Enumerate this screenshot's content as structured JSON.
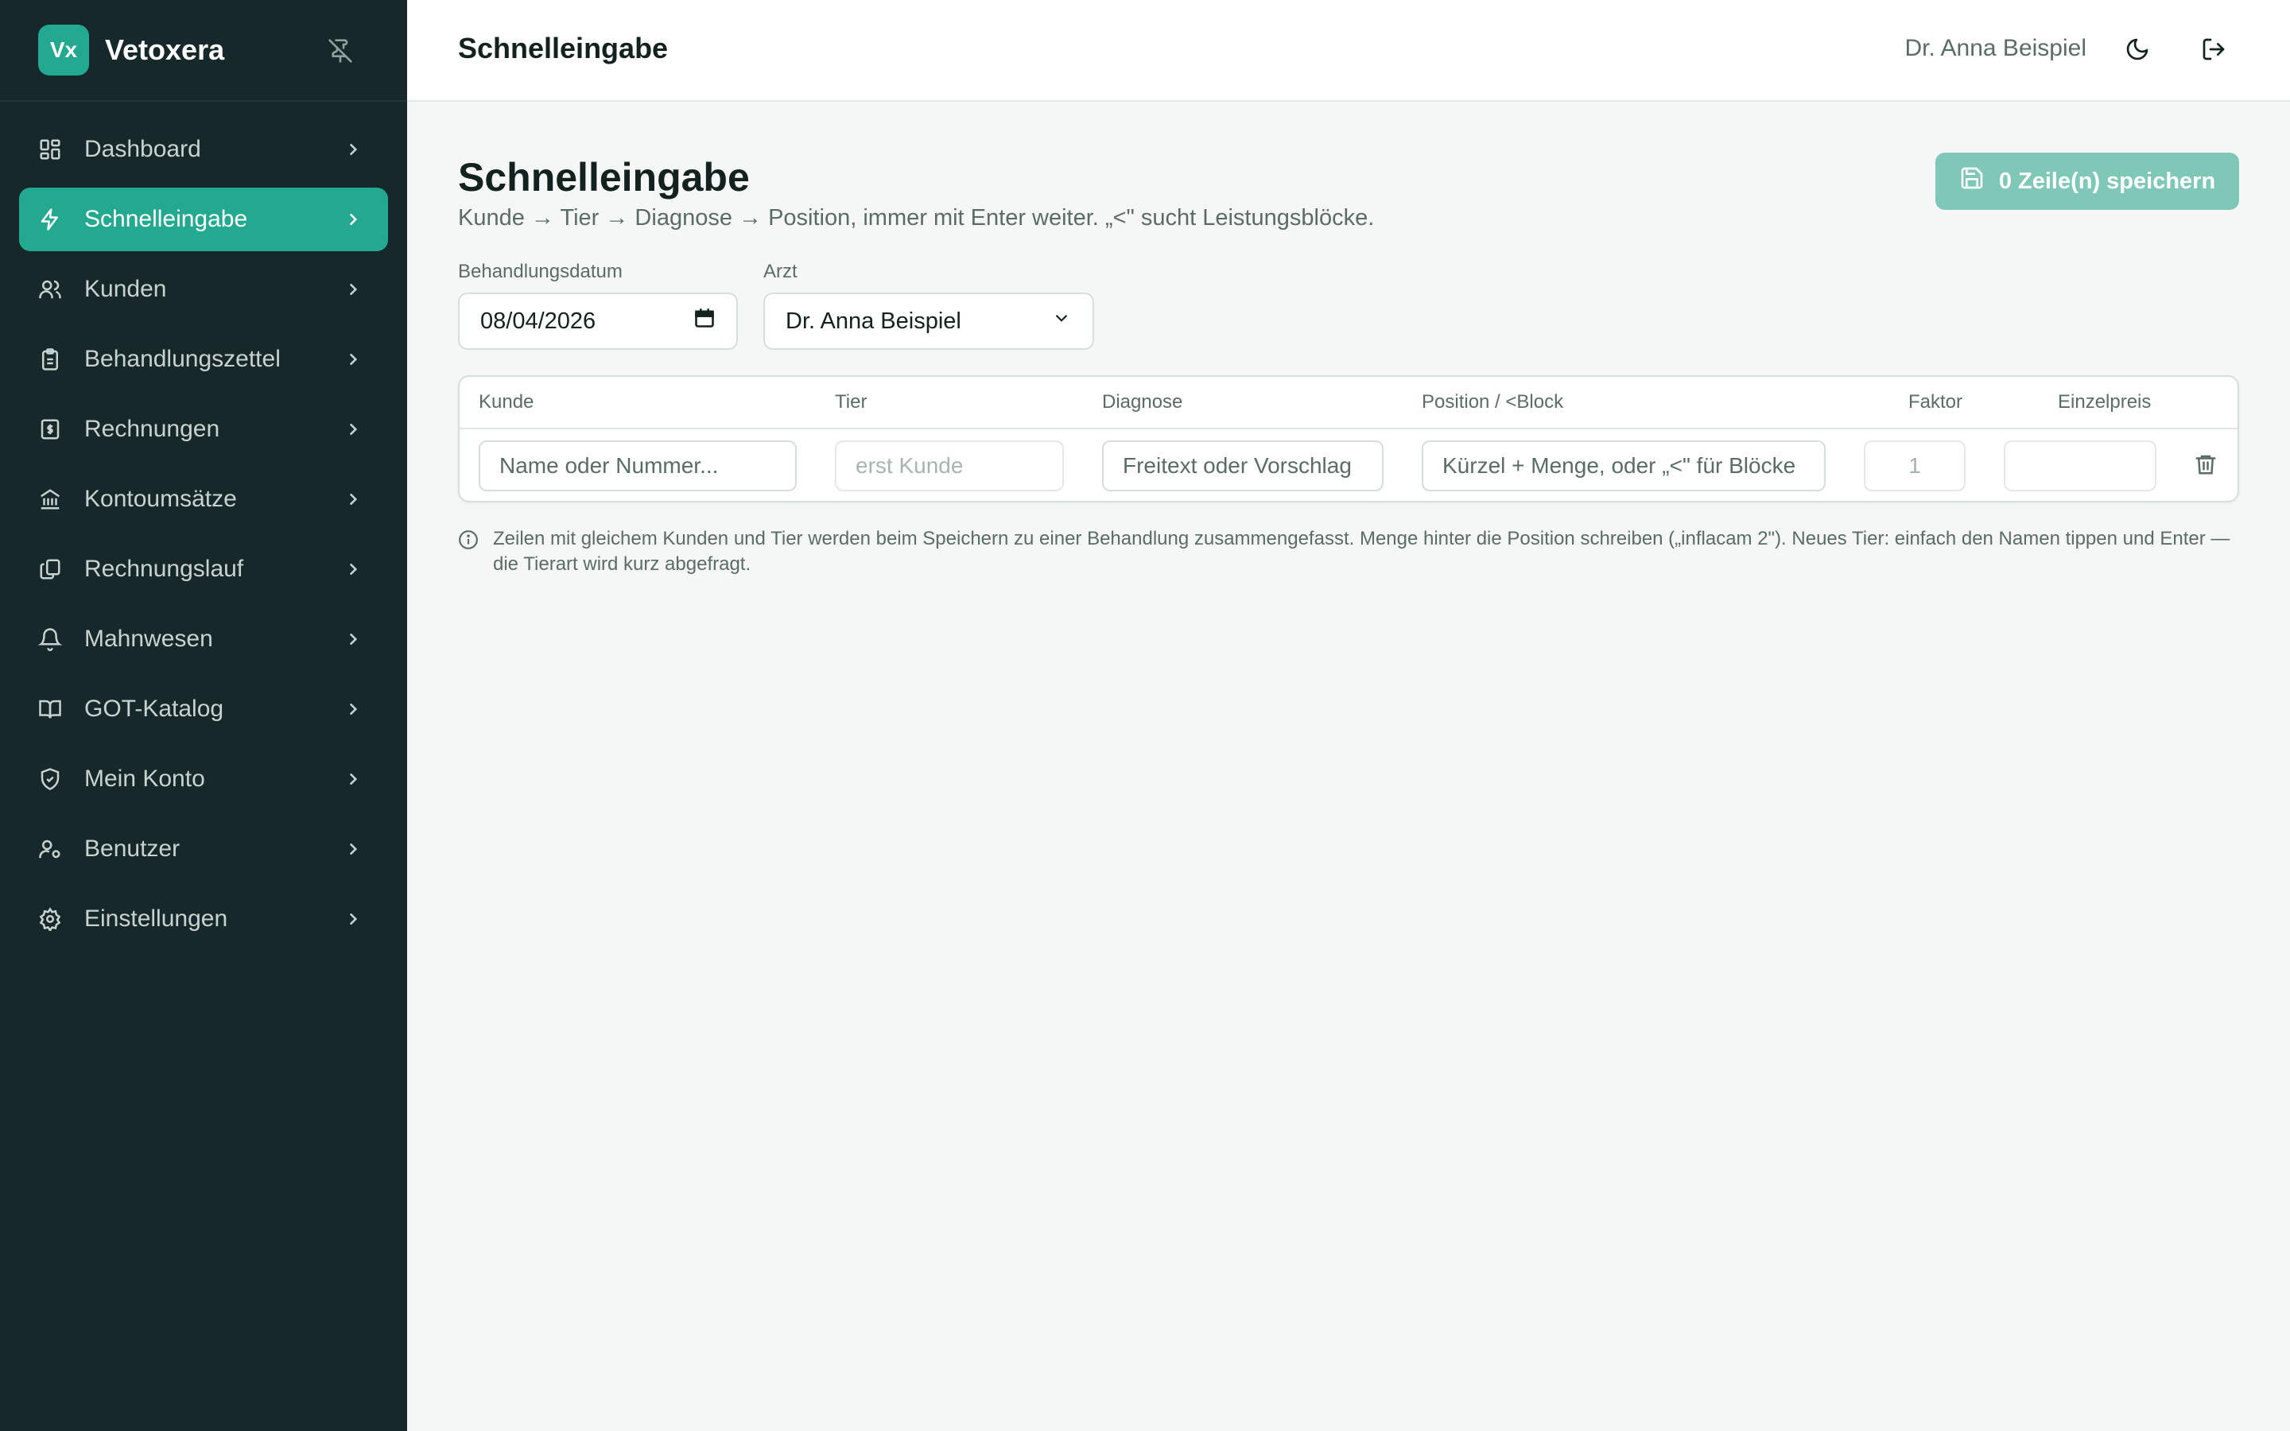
{
  "app": {
    "logo_text": "Vx",
    "name": "Vetoxera"
  },
  "sidebar": {
    "items": [
      {
        "label": "Dashboard",
        "icon": "dashboard-icon",
        "active": false
      },
      {
        "label": "Schnelleingabe",
        "icon": "bolt-icon",
        "active": true
      },
      {
        "label": "Kunden",
        "icon": "users-icon",
        "active": false
      },
      {
        "label": "Behandlungszettel",
        "icon": "clipboard-icon",
        "active": false
      },
      {
        "label": "Rechnungen",
        "icon": "invoice-icon",
        "active": false
      },
      {
        "label": "Kontoumsätze",
        "icon": "bank-icon",
        "active": false
      },
      {
        "label": "Rechnungslauf",
        "icon": "copy-icon",
        "active": false
      },
      {
        "label": "Mahnwesen",
        "icon": "bell-icon",
        "active": false
      },
      {
        "label": "GOT-Katalog",
        "icon": "book-icon",
        "active": false
      },
      {
        "label": "Mein Konto",
        "icon": "shield-icon",
        "active": false
      },
      {
        "label": "Benutzer",
        "icon": "user-settings-icon",
        "active": false
      },
      {
        "label": "Einstellungen",
        "icon": "gear-icon",
        "active": false
      }
    ]
  },
  "header": {
    "title": "Schnelleingabe",
    "user_name": "Dr. Anna Beispiel"
  },
  "main": {
    "title": "Schnelleingabe",
    "subtitle": "Kunde → Tier → Diagnose → Position, immer mit Enter weiter. „<\" sucht Leistungsblöcke.",
    "save_button": "0 Zeile(n) speichern",
    "date_label": "Behandlungsdatum",
    "date_value": "08/04/2026",
    "doctor_label": "Arzt",
    "doctor_value": "Dr. Anna Beispiel",
    "table": {
      "headers": {
        "kunde": "Kunde",
        "tier": "Tier",
        "diagnose": "Diagnose",
        "position": "Position / <Block",
        "faktor": "Faktor",
        "einzelpreis": "Einzelpreis"
      },
      "row": {
        "kunde_placeholder": "Name oder Nummer...",
        "tier_placeholder": "erst Kunde",
        "diagnose_placeholder": "Freitext oder Vorschlag",
        "position_placeholder": "Kürzel + Menge, oder „<\" für Blöcke",
        "faktor_value": "1",
        "einzelpreis_value": ""
      }
    },
    "hint": "Zeilen mit gleichem Kunden und Tier werden beim Speichern zu einer Behandlung zusammengefasst. Menge hinter die Position schreiben („inflacam 2\"). Neues Tier: einfach den Namen tippen und Enter — die Tierart wird kurz abgefragt."
  },
  "colors": {
    "sidebar_bg": "#17282a",
    "accent": "#23a98f",
    "save_button_bg": "#7fc8b8"
  }
}
